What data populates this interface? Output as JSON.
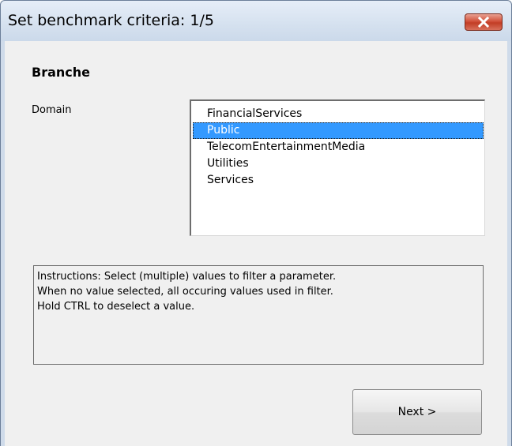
{
  "window": {
    "title": "Set benchmark criteria: 1/5"
  },
  "section": {
    "heading": "Branche"
  },
  "domain": {
    "label": "Domain",
    "options": [
      {
        "label": "FinancialServices",
        "selected": false
      },
      {
        "label": "Public",
        "selected": true
      },
      {
        "label": "TelecomEntertainmentMedia",
        "selected": false
      },
      {
        "label": "Utilities",
        "selected": false
      },
      {
        "label": "Services",
        "selected": false
      }
    ]
  },
  "instructions": {
    "lines": [
      "Instructions: Select (multiple) values to filter a parameter.",
      "When no value selected, all occuring values used in filter.",
      "Hold CTRL to deselect a value."
    ]
  },
  "buttons": {
    "next_label": "Next >"
  },
  "colors": {
    "selection": "#3399ff",
    "close_button": "#c8432a",
    "dialog_bg": "#f0f0f0"
  }
}
